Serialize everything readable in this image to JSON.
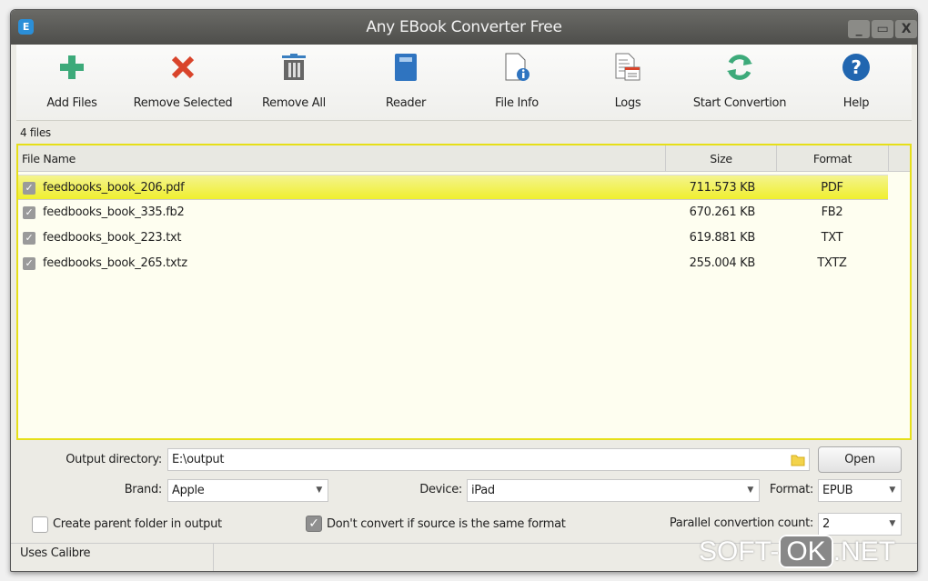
{
  "window": {
    "title": "Any EBook Converter Free",
    "app_icon": "E",
    "controls": {
      "minimize": "_",
      "maximize": "▭",
      "close": "X"
    }
  },
  "toolbar": [
    {
      "label": "Add Files",
      "icon": "plus-icon"
    },
    {
      "label": "Remove Selected",
      "icon": "x-icon"
    },
    {
      "label": "Remove All",
      "icon": "trash-icon"
    },
    {
      "label": "Reader",
      "icon": "book-icon"
    },
    {
      "label": "File Info",
      "icon": "file-info-icon"
    },
    {
      "label": "Logs",
      "icon": "logs-icon"
    },
    {
      "label": "Start Convertion",
      "icon": "refresh-icon"
    },
    {
      "label": "Help",
      "icon": "help-icon"
    }
  ],
  "file_count": "4 files",
  "table": {
    "columns": [
      "File Name",
      "Size",
      "Format"
    ],
    "rows": [
      {
        "name": "feedbooks_book_206.pdf",
        "size": "711.573 KB",
        "format": "PDF",
        "checked": true,
        "selected": true
      },
      {
        "name": "feedbooks_book_335.fb2",
        "size": "670.261 KB",
        "format": "FB2",
        "checked": true
      },
      {
        "name": "feedbooks_book_223.txt",
        "size": "619.881 KB",
        "format": "TXT",
        "checked": true
      },
      {
        "name": "feedbooks_book_265.txtz",
        "size": "255.004 KB",
        "format": "TXTZ",
        "checked": true
      }
    ]
  },
  "options": {
    "output_label": "Output directory:",
    "output_value": "E:\\output",
    "open_label": "Open",
    "brand_label": "Brand:",
    "brand_value": "Apple",
    "device_label": "Device:",
    "device_value": "iPad",
    "format_label": "Format:",
    "format_value": "EPUB",
    "create_parent_label": "Create parent folder in output",
    "create_parent_checked": false,
    "dont_convert_label": "Don't convert if source is the same format",
    "dont_convert_checked": true,
    "parallel_label": "Parallel convertion count:",
    "parallel_value": "2"
  },
  "status": "Uses Calibre",
  "watermark": {
    "a": "SOFT-",
    "b": "OK",
    ".c": ".NET",
    "c": ".NET"
  }
}
